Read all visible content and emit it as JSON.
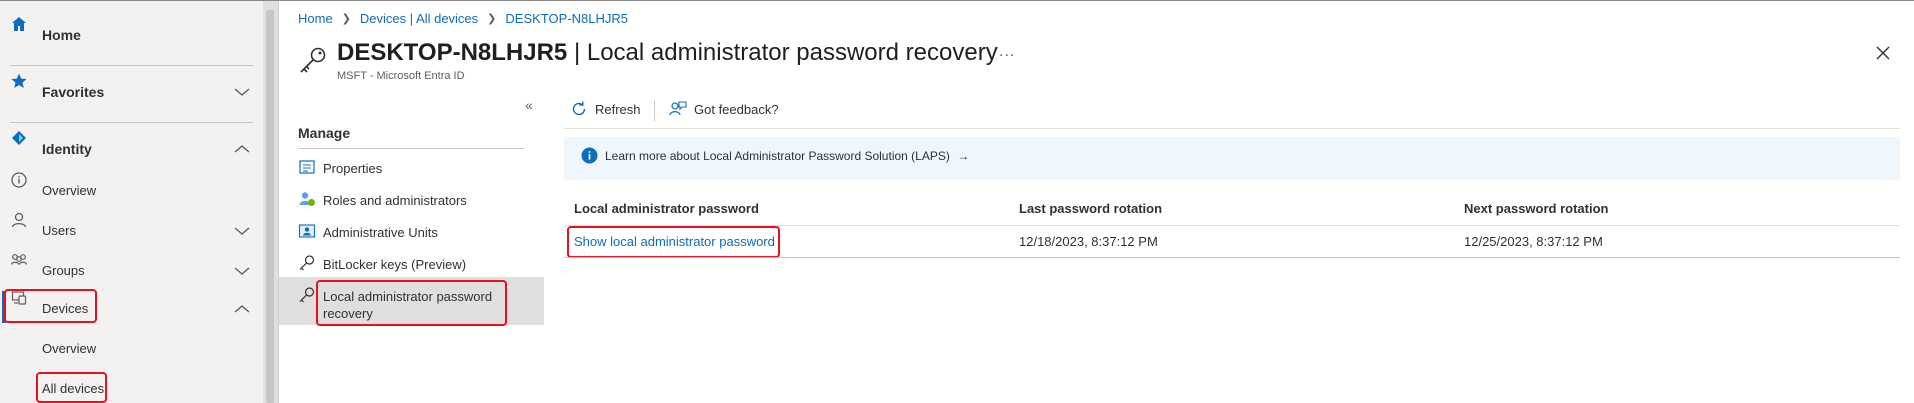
{
  "nav": {
    "items": [
      {
        "label": "Home",
        "icon": "home-icon"
      },
      {
        "label": "Favorites",
        "icon": "star-icon"
      },
      {
        "label": "Identity",
        "icon": "identity-icon"
      },
      {
        "label": "Overview",
        "icon": "info-icon"
      },
      {
        "label": "Users",
        "icon": "user-icon"
      },
      {
        "label": "Groups",
        "icon": "groups-icon"
      },
      {
        "label": "Devices",
        "icon": "devices-icon"
      }
    ],
    "sub_items": [
      {
        "label": "Overview"
      },
      {
        "label": "All devices"
      }
    ]
  },
  "breadcrumb": [
    "Home",
    "Devices | All devices",
    "DESKTOP-N8LHJR5"
  ],
  "header": {
    "device": "DESKTOP-N8LHJR5",
    "page": "| Local administrator password recovery",
    "more": "...",
    "subtitle": "MSFT - Microsoft Entra ID"
  },
  "resource_menu": {
    "collapse": "«",
    "section": "Manage",
    "items": [
      {
        "label": "Properties",
        "icon": "properties-icon"
      },
      {
        "label": "Roles and administrators",
        "icon": "roles-icon"
      },
      {
        "label": "Administrative Units",
        "icon": "admin-units-icon"
      },
      {
        "label": "BitLocker keys (Preview)",
        "icon": "key-icon"
      },
      {
        "label": "Local administrator password recovery",
        "icon": "key-icon"
      }
    ]
  },
  "toolbar": {
    "refresh": "Refresh",
    "feedback": "Got feedback?"
  },
  "info": {
    "text": "Learn more about Local Administrator Password Solution (LAPS)",
    "arrow": "→"
  },
  "table": {
    "headers": [
      "Local administrator password",
      "Last password rotation",
      "Next password rotation"
    ],
    "row": {
      "action": "Show local administrator password",
      "last": "12/18/2023, 8:37:12 PM",
      "next": "12/25/2023, 8:37:12 PM"
    }
  },
  "colors": {
    "accent": "#0f6cbd",
    "highlight": "#e81123",
    "nav_bg": "#f3f2f1",
    "info_bg": "#eff6fc"
  }
}
